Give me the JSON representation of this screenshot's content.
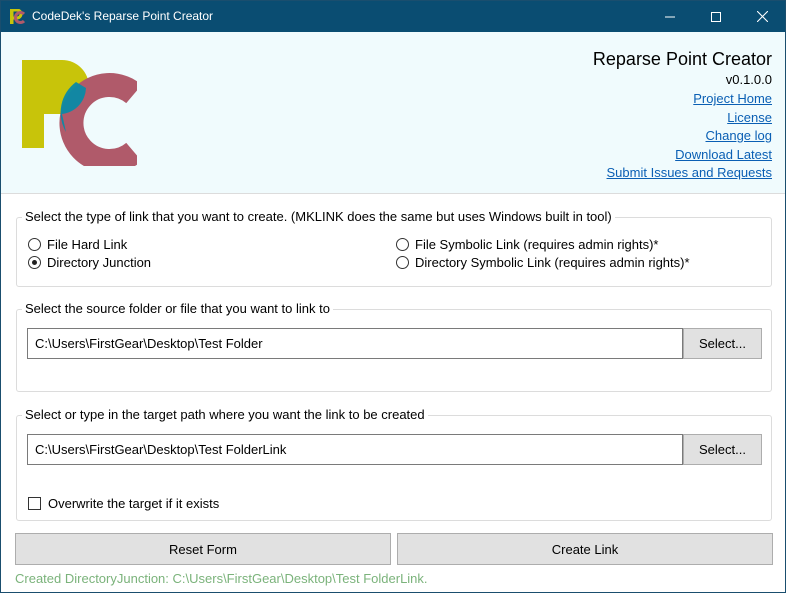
{
  "window": {
    "title": "CodeDek's Reparse Point Creator",
    "titlebar_color": "#0a4d72"
  },
  "header": {
    "app_name": "Reparse Point Creator",
    "version": "v0.1.0.0",
    "links": [
      "Project Home",
      "License",
      "Change log",
      "Download Latest",
      "Submit Issues and Requests"
    ],
    "link_color": "#0a5fb4",
    "background": "#f0fbfd"
  },
  "logo": {
    "icon": "rpc-logo",
    "text": "RC",
    "colors": [
      "#c8c40a",
      "#0a8aa6",
      "#b05a6a"
    ]
  },
  "link_type": {
    "legend": "Select the type of link that you want to create. (MKLINK does the same but uses Windows built in tool)",
    "options": [
      {
        "label": "File Hard Link",
        "checked": false
      },
      {
        "label": "Directory Junction",
        "checked": true
      },
      {
        "label": "File Symbolic Link (requires admin rights)*",
        "checked": false
      },
      {
        "label": "Directory Symbolic Link (requires admin rights)*",
        "checked": false
      }
    ]
  },
  "source": {
    "legend": "Select the source folder or file that you want to link to",
    "value": "C:\\Users\\FirstGear\\Desktop\\Test Folder",
    "select_label": "Select..."
  },
  "target": {
    "legend": "Select or type in the target path where you want the link to be created",
    "value": "C:\\Users\\FirstGear\\Desktop\\Test FolderLink",
    "select_label": "Select...",
    "overwrite_label": "Overwrite the target if it exists",
    "overwrite_checked": false
  },
  "actions": {
    "reset_label": "Reset Form",
    "create_label": "Create Link"
  },
  "status": {
    "text": "Created DirectoryJunction: C:\\Users\\FirstGear\\Desktop\\Test FolderLink.",
    "color": "#7bb37b"
  }
}
